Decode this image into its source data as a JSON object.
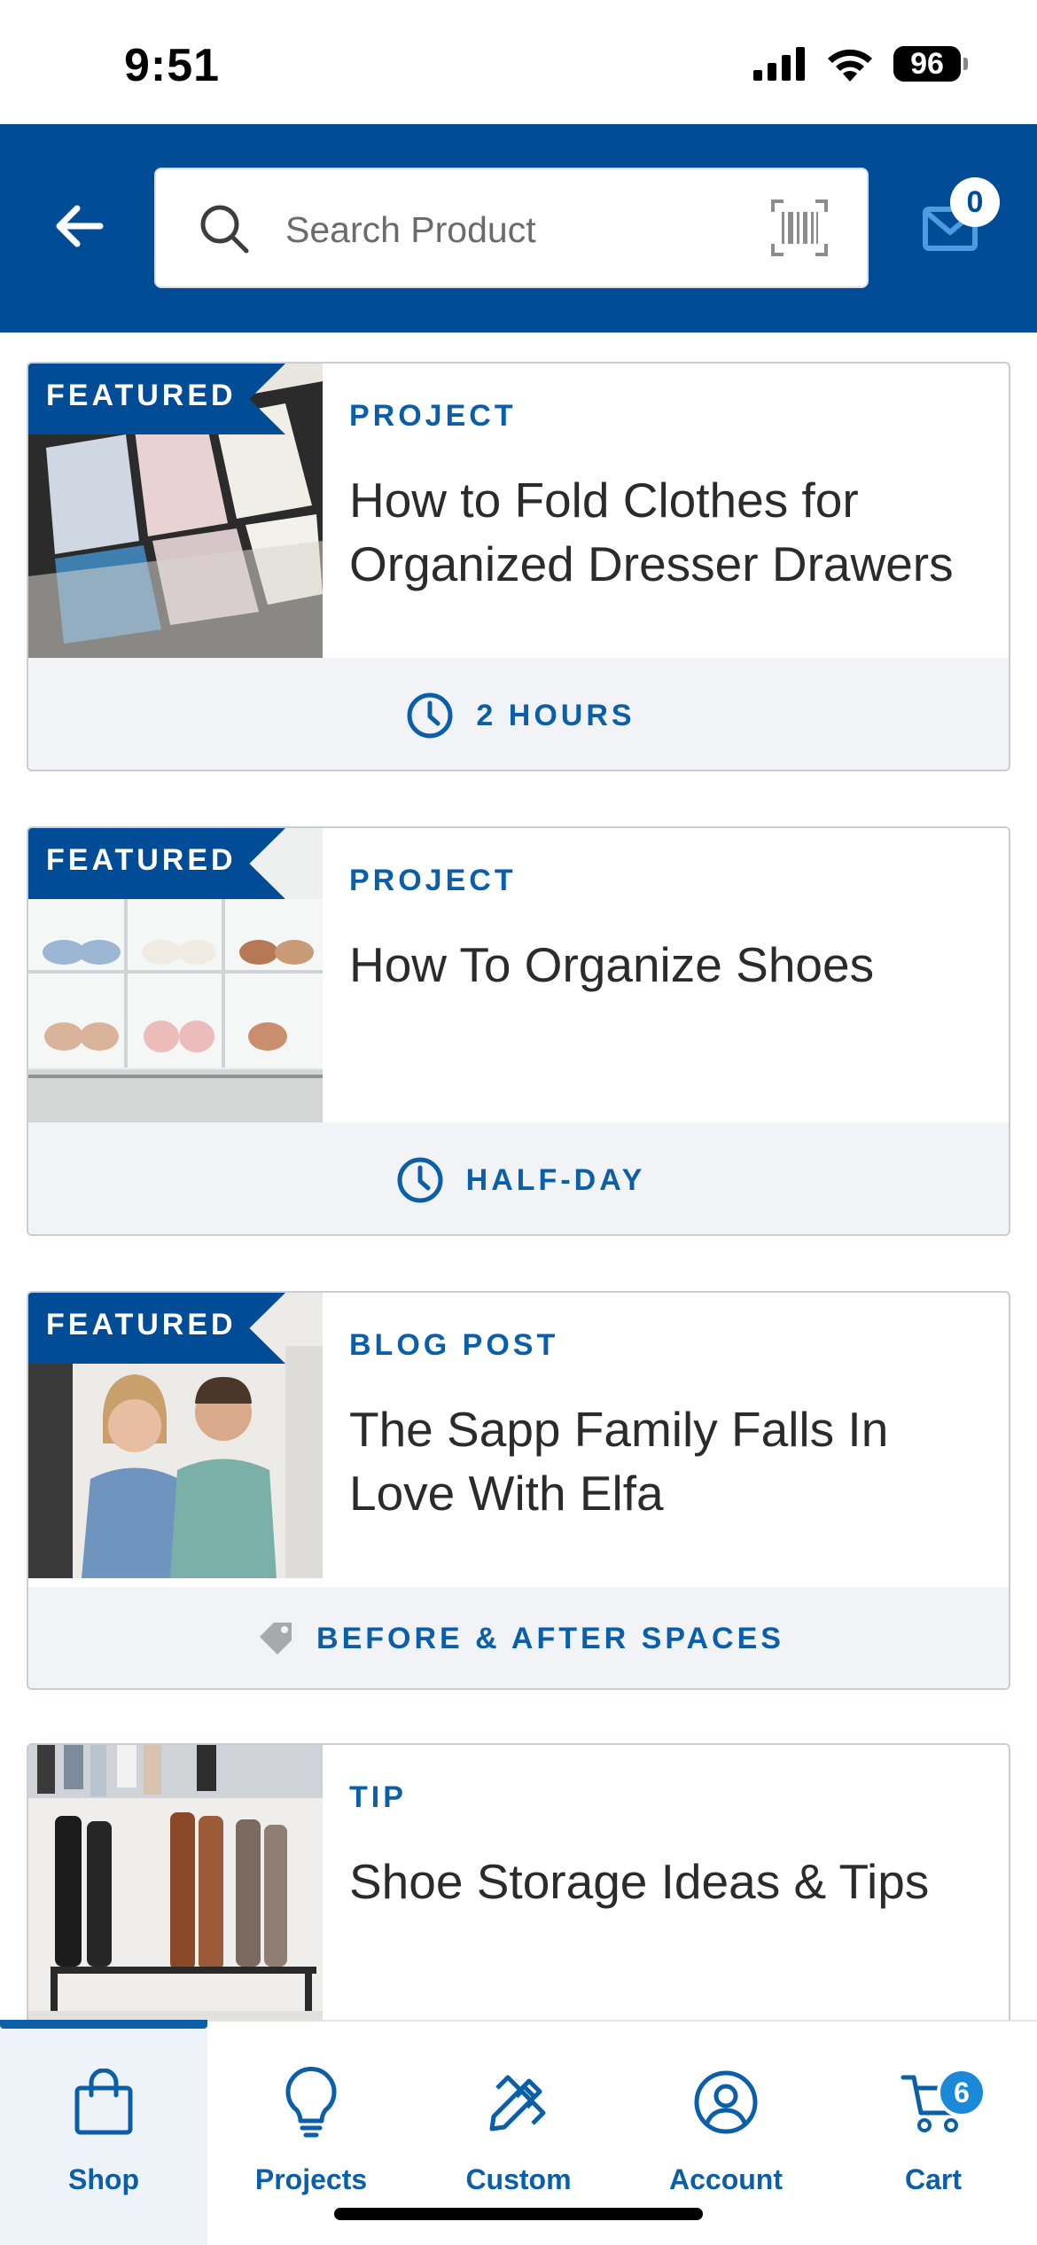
{
  "status_bar": {
    "time": "9:51",
    "battery": "96"
  },
  "header": {
    "search": {
      "placeholder": "Search Product"
    },
    "mail_count": "0"
  },
  "cards": [
    {
      "featured_label": "FEATURED",
      "type": "PROJECT",
      "title": "How to Fold Clothes for Organized Dresser Drawers",
      "footer_icon": "clock-icon",
      "footer_text": "2 HOURS"
    },
    {
      "featured_label": "FEATURED",
      "type": "PROJECT",
      "title": "How To Organize Shoes",
      "footer_icon": "clock-icon",
      "footer_text": "HALF-DAY"
    },
    {
      "featured_label": "FEATURED",
      "type": "BLOG POST",
      "title": "The Sapp Family Falls In Love With Elfa",
      "footer_icon": "tag-icon",
      "footer_text": "BEFORE & AFTER SPACES"
    },
    {
      "type": "TIP",
      "title": "Shoe Storage Ideas & Tips"
    }
  ],
  "bottom_nav": {
    "items": [
      {
        "label": "Shop",
        "icon": "shopping-bag-icon",
        "active": true
      },
      {
        "label": "Projects",
        "icon": "lightbulb-icon"
      },
      {
        "label": "Custom",
        "icon": "pencil-ruler-icon"
      },
      {
        "label": "Account",
        "icon": "user-circle-icon"
      },
      {
        "label": "Cart",
        "icon": "cart-icon",
        "badge": "6"
      }
    ]
  },
  "colors": {
    "brand_blue": "#004c97",
    "accent_blue": "#0a5fa8",
    "footer_bg": "#f2f3f7"
  }
}
